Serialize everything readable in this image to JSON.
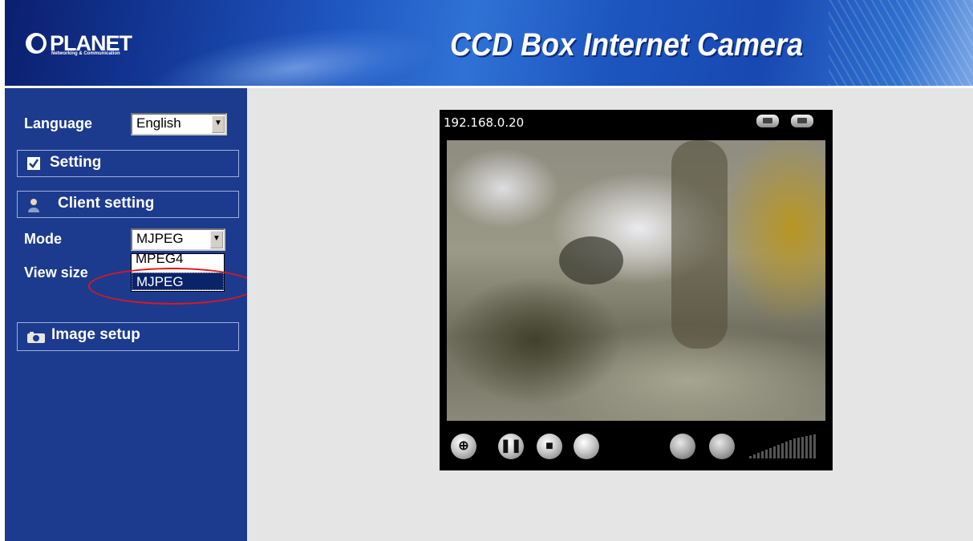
{
  "header": {
    "brand": "PLANET",
    "brand_tagline": "Networking & Communication",
    "title": "CCD Box Internet Camera"
  },
  "sidebar": {
    "language_label": "Language",
    "language_value": "English",
    "setting_label": "Setting",
    "client_setting_label": "Client setting",
    "mode_label": "Mode",
    "mode_value": "MJPEG",
    "mode_options": [
      "MPEG4",
      "MJPEG"
    ],
    "view_size_label": "View size",
    "image_setup_label": "Image setup",
    "annotation_color": "#e0161b"
  },
  "viewer": {
    "ip_address": "192.168.0.20",
    "controls": [
      "zoom-icon",
      "pause-icon",
      "stop-icon",
      "record-icon",
      "snapshot-icon",
      "audio-icon"
    ]
  },
  "colors": {
    "sidebar_bg": "#1d3b8e",
    "main_bg": "#e5e5e5",
    "viewer_bg": "#000000",
    "selected_option_bg": "#0a246a"
  }
}
